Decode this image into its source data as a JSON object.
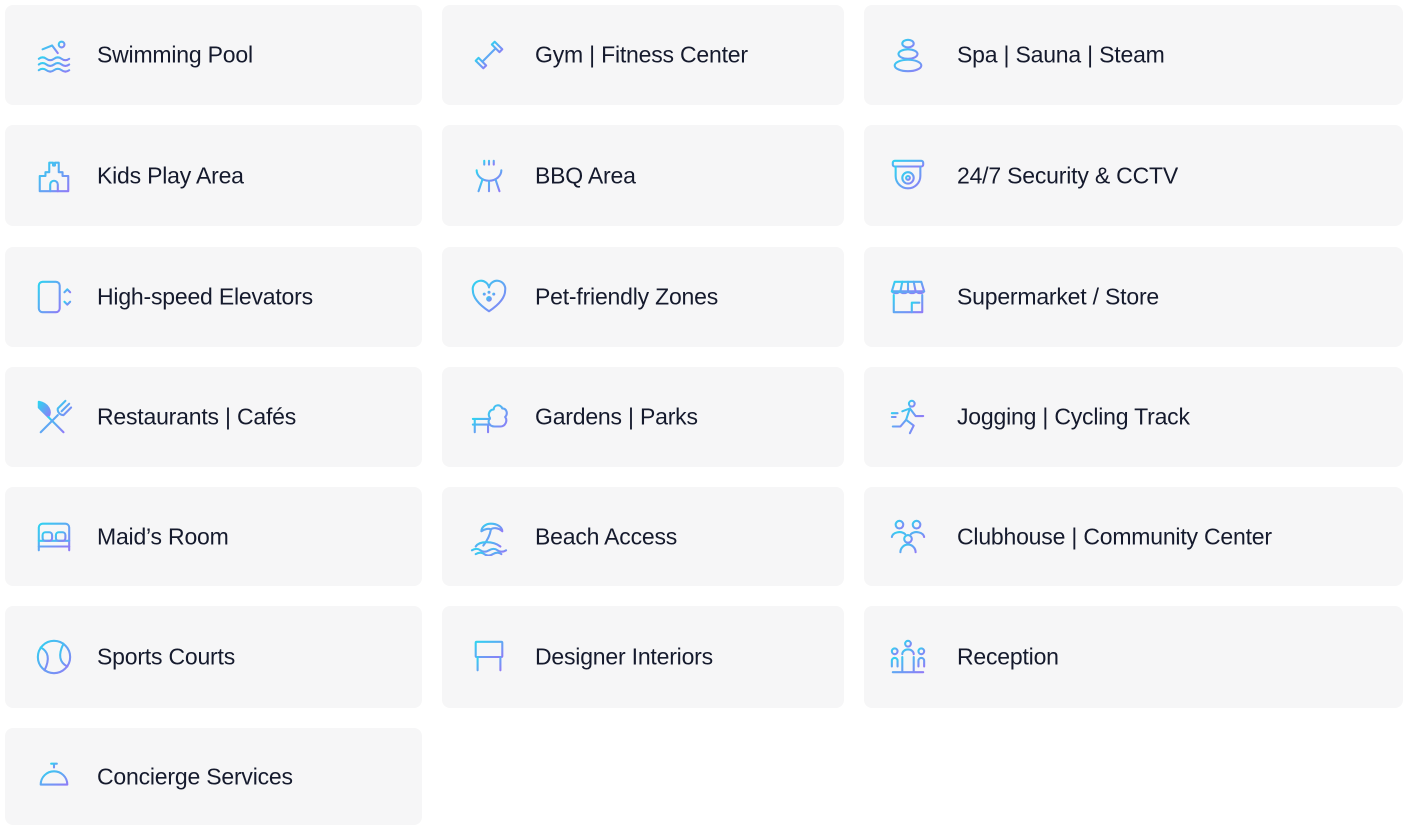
{
  "colors": {
    "card_background": "#f6f6f7",
    "text": "#151a2d",
    "icon_gradient_start": "#2fd3f0",
    "icon_gradient_end": "#8f7cf7"
  },
  "amenities": [
    {
      "label": "Swimming Pool",
      "icon": "swimming-pool-icon"
    },
    {
      "label": "Gym | Fitness Center",
      "icon": "dumbbell-icon"
    },
    {
      "label": "Spa | Sauna | Steam",
      "icon": "spa-stones-icon"
    },
    {
      "label": "Kids Play Area",
      "icon": "castle-icon"
    },
    {
      "label": "BBQ Area",
      "icon": "grill-icon"
    },
    {
      "label": "24/7 Security & CCTV",
      "icon": "cctv-camera-icon"
    },
    {
      "label": "High-speed Elevators",
      "icon": "elevator-icon"
    },
    {
      "label": "Pet-friendly Zones",
      "icon": "paw-heart-icon"
    },
    {
      "label": "Supermarket / Store",
      "icon": "store-icon"
    },
    {
      "label": "Restaurants | Cafés",
      "icon": "fork-knife-icon"
    },
    {
      "label": "Gardens | Parks",
      "icon": "park-bench-tree-icon"
    },
    {
      "label": "Jogging | Cycling Track",
      "icon": "runner-icon"
    },
    {
      "label": "Maid’s Room",
      "icon": "bed-icon"
    },
    {
      "label": "Beach Access",
      "icon": "island-palm-icon"
    },
    {
      "label": "Clubhouse | Community Center",
      "icon": "community-people-icon"
    },
    {
      "label": "Sports Courts",
      "icon": "tennis-ball-icon"
    },
    {
      "label": "Designer Interiors",
      "icon": "window-frame-icon"
    },
    {
      "label": "Reception",
      "icon": "reception-desk-icon"
    },
    {
      "label": "Concierge Services",
      "icon": "service-bell-icon"
    }
  ]
}
